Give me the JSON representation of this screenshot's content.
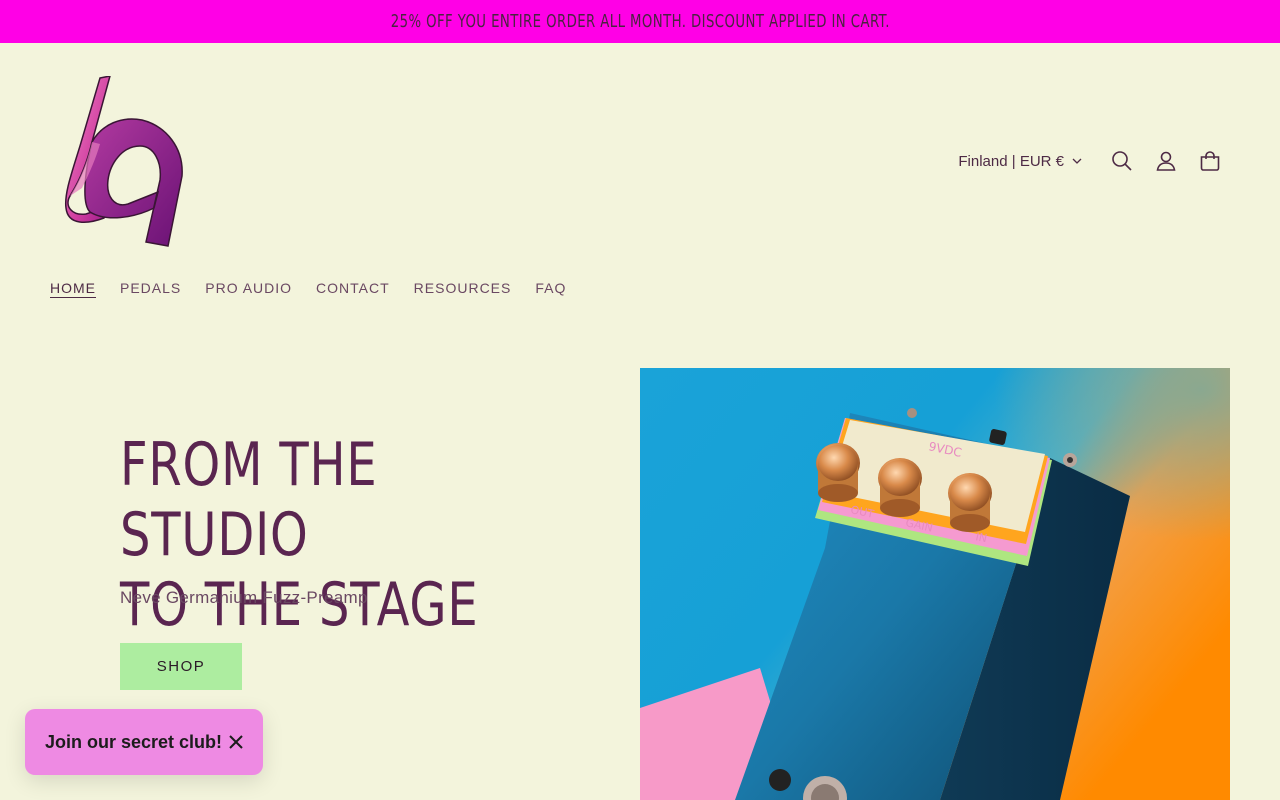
{
  "announcement": {
    "text": "25% OFF YOU ENTIRE ORDER ALL MONTH. DISCOUNT APPLIED IN CART."
  },
  "header": {
    "logo_icon": "ribbon-logo-icon",
    "country_selector": "Finland | EUR €",
    "icons": [
      "search-icon",
      "account-icon",
      "cart-icon"
    ]
  },
  "nav": {
    "items": [
      {
        "label": "HOME",
        "active": true
      },
      {
        "label": "PEDALS",
        "active": false
      },
      {
        "label": "PRO AUDIO",
        "active": false
      },
      {
        "label": "CONTACT",
        "active": false
      },
      {
        "label": "RESOURCES",
        "active": false
      },
      {
        "label": "FAQ",
        "active": false
      }
    ]
  },
  "hero": {
    "title": "FROM THE STUDIO\nTO THE STAGE",
    "subtitle": "Neve Germanium Fuzz-Preamp",
    "button": "SHOP",
    "image_labels": [
      "9VDC",
      "OUT",
      "GAIN",
      "IN"
    ]
  },
  "popup": {
    "text": "Join our secret club!",
    "close_icon": "close-icon"
  },
  "colors": {
    "background": "#f3f4dc",
    "announcement_bar": "#ff00e6",
    "title": "#5a2550",
    "shop_button": "#adeda0",
    "popup": "#ee8ae3"
  }
}
